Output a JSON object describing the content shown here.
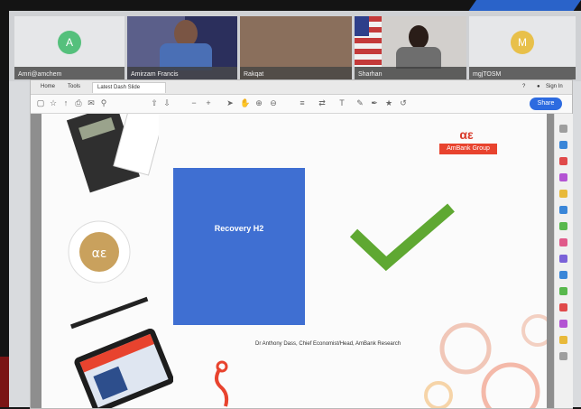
{
  "participants": [
    {
      "name": "Amri@amchem",
      "initial": "A",
      "avatar_color": "#55c07c"
    },
    {
      "name": "Amirzam Francis",
      "initial": "",
      "avatar_color": ""
    },
    {
      "name": "Rakqat",
      "initial": "",
      "avatar_color": ""
    },
    {
      "name": "Sharhan",
      "initial": "",
      "avatar_color": ""
    },
    {
      "name": "mgjTOSM",
      "initial": "M",
      "avatar_color": "#e8c04a"
    }
  ],
  "viewer": {
    "tabs": [
      "Home",
      "Tools",
      "Latest Dash Slide"
    ],
    "page_label": "Sign In",
    "share_label": "Share"
  },
  "slide": {
    "logo_text": "AmBank Group",
    "box_title": "Recovery H2",
    "presenter": "Dr Anthony Dass, Chief Economist/Head, AmBank Research"
  },
  "colors": {
    "accent": "#2d6be0",
    "box": "#3f6fd2",
    "check": "#5fa832",
    "brand": "#e8432e"
  }
}
